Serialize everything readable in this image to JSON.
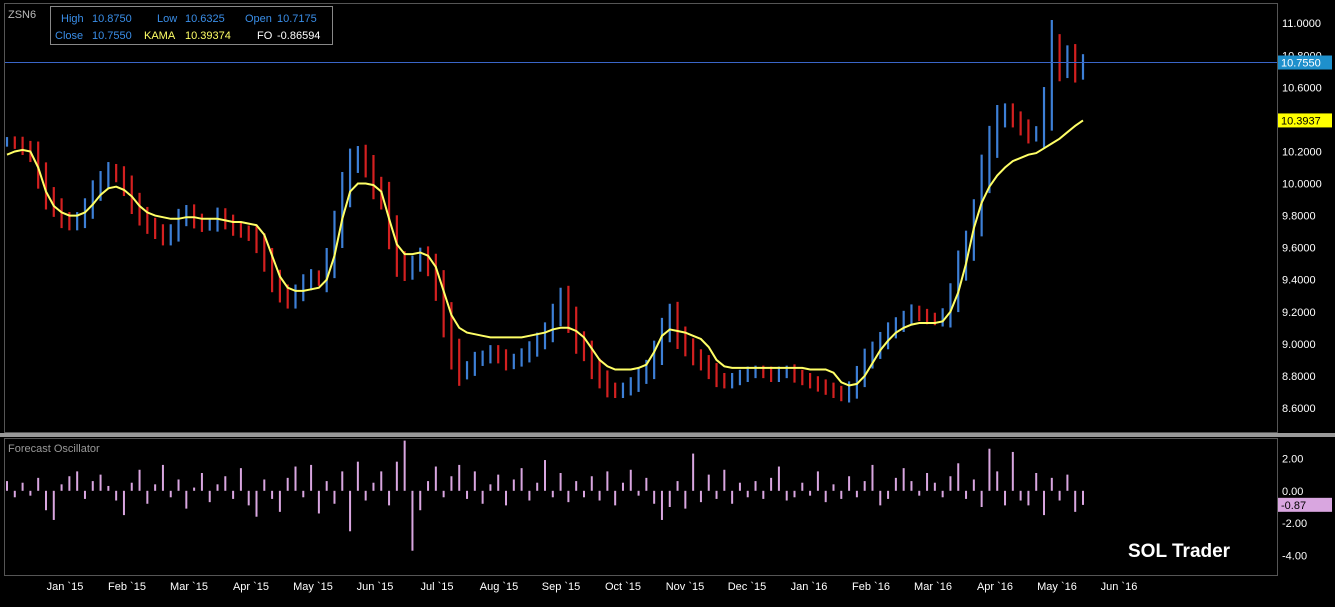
{
  "symbol": "ZSN6",
  "info_box": {
    "high_label": "High",
    "high_value": "10.8750",
    "low_label": "Low",
    "low_value": "10.6325",
    "open_label": "Open",
    "open_value": "10.7175",
    "close_label": "Close",
    "close_value": "10.7550",
    "kama_label": "KAMA",
    "kama_value": "10.39374",
    "fo_label": "FO",
    "fo_value": "-0.86594"
  },
  "indicator_title": "Forecast Oscillator",
  "watermark": "SOL Trader",
  "colors": {
    "background": "#000000",
    "up_bar": "#3d7fd6",
    "down_bar": "#d42020",
    "kama_line": "#ffff66",
    "close_line": "#3a66c8",
    "close_tag": "#1e90cc",
    "kama_tag": "#ffff00",
    "oscillator_bar": "#d9a6e0",
    "axis_text": "#ffffff",
    "border": "#555555"
  },
  "chart_data": [
    {
      "type": "bar",
      "subtype": "ohlc-price",
      "title": "",
      "xlabel": "",
      "ylabel": "",
      "x_tick_labels": [
        "Jan `15",
        "Feb `15",
        "Mar `15",
        "Apr `15",
        "May `15",
        "Jun `15",
        "Jul `15",
        "Aug `15",
        "Sep `15",
        "Oct `15",
        "Nov `15",
        "Dec `15",
        "Jan `16",
        "Feb `16",
        "Mar `16",
        "Apr `16",
        "May `16",
        "Jun `16"
      ],
      "y_tick_labels": [
        "11.0000",
        "10.8000",
        "10.6000",
        "10.4000",
        "10.2000",
        "10.0000",
        "9.8000",
        "9.6000",
        "9.4000",
        "9.2000",
        "9.0000",
        "8.8000",
        "8.6000"
      ],
      "ylim": [
        8.45,
        11.12
      ],
      "grid": false,
      "last_close": 10.755,
      "last_close_label": "10.7550",
      "last_kama": 10.3937,
      "last_kama_label": "10.3937",
      "series": [
        {
          "name": "Close",
          "values": [
            10.26,
            10.25,
            10.22,
            10.18,
            10.05,
            9.92,
            9.85,
            9.78,
            9.75,
            9.78,
            9.85,
            9.95,
            10.02,
            10.08,
            10.05,
            9.98,
            9.88,
            9.8,
            9.74,
            9.7,
            9.66,
            9.7,
            9.78,
            9.82,
            9.77,
            9.74,
            9.75,
            9.8,
            9.76,
            9.72,
            9.7,
            9.68,
            9.62,
            9.52,
            9.4,
            9.32,
            9.27,
            9.32,
            9.38,
            9.42,
            9.4,
            9.52,
            9.72,
            9.95,
            10.12,
            10.18,
            10.1,
            9.98,
            9.9,
            9.7,
            9.52,
            9.45,
            9.5,
            9.55,
            9.48,
            9.35,
            9.15,
            8.95,
            8.82,
            8.85,
            8.9,
            8.92,
            8.95,
            8.92,
            8.88,
            8.9,
            8.93,
            8.97,
            9.02,
            9.08,
            9.18,
            9.28,
            9.15,
            9.02,
            8.95,
            8.85,
            8.78,
            8.72,
            8.7,
            8.72,
            8.75,
            8.8,
            8.85,
            8.95,
            9.08,
            9.18,
            9.05,
            8.98,
            8.92,
            8.88,
            8.83,
            8.78,
            8.76,
            8.78,
            8.8,
            8.82,
            8.83,
            8.82,
            8.8,
            8.82,
            8.83,
            8.8,
            8.78,
            8.76,
            8.74,
            8.72,
            8.7,
            8.68,
            8.72,
            8.8,
            8.9,
            8.96,
            9.02,
            9.08,
            9.12,
            9.16,
            9.2,
            9.18,
            9.16,
            9.15,
            9.18,
            9.3,
            9.48,
            9.62,
            9.8,
            10.05,
            10.25,
            10.4,
            10.45,
            10.4,
            10.35,
            10.3,
            10.32,
            10.5,
            10.85,
            10.72,
            10.8,
            10.7,
            10.755
          ]
        },
        {
          "name": "KAMA",
          "values": [
            10.18,
            10.2,
            10.21,
            10.2,
            10.1,
            9.95,
            9.86,
            9.82,
            9.8,
            9.8,
            9.82,
            9.87,
            9.93,
            9.97,
            9.98,
            9.96,
            9.92,
            9.86,
            9.82,
            9.8,
            9.79,
            9.78,
            9.78,
            9.79,
            9.79,
            9.78,
            9.78,
            9.78,
            9.77,
            9.76,
            9.76,
            9.75,
            9.74,
            9.68,
            9.55,
            9.42,
            9.35,
            9.33,
            9.33,
            9.34,
            9.35,
            9.4,
            9.55,
            9.78,
            9.95,
            10.0,
            10.0,
            9.99,
            9.95,
            9.78,
            9.62,
            9.56,
            9.56,
            9.57,
            9.55,
            9.48,
            9.33,
            9.18,
            9.1,
            9.07,
            9.06,
            9.05,
            9.04,
            9.04,
            9.04,
            9.04,
            9.04,
            9.05,
            9.06,
            9.07,
            9.09,
            9.1,
            9.1,
            9.08,
            9.04,
            8.97,
            8.9,
            8.86,
            8.84,
            8.84,
            8.84,
            8.85,
            8.87,
            8.95,
            9.05,
            9.09,
            9.08,
            9.07,
            9.05,
            9.03,
            8.98,
            8.9,
            8.86,
            8.85,
            8.85,
            8.85,
            8.85,
            8.85,
            8.85,
            8.85,
            8.85,
            8.85,
            8.85,
            8.84,
            8.84,
            8.84,
            8.82,
            8.76,
            8.74,
            8.75,
            8.8,
            8.88,
            8.96,
            9.02,
            9.07,
            9.1,
            9.12,
            9.13,
            9.13,
            9.13,
            9.14,
            9.2,
            9.32,
            9.5,
            9.72,
            9.88,
            9.98,
            10.05,
            10.1,
            10.14,
            10.16,
            10.18,
            10.19,
            10.22,
            10.25,
            10.28,
            10.32,
            10.36,
            10.39374
          ]
        }
      ]
    },
    {
      "type": "bar",
      "subtype": "oscillator",
      "title": "Forecast Oscillator",
      "y_tick_labels": [
        "2.00",
        "0.00",
        "-2.00",
        "-4.00"
      ],
      "ylim": [
        -5.2,
        3.2
      ],
      "last_value": -0.86594,
      "last_value_label": "-0.87",
      "values": [
        0.6,
        -0.4,
        0.5,
        -0.3,
        0.8,
        -1.2,
        -1.8,
        0.4,
        0.9,
        1.2,
        -0.5,
        0.6,
        1.0,
        0.3,
        -0.6,
        -1.5,
        0.5,
        1.3,
        -0.8,
        0.4,
        1.6,
        -0.4,
        0.7,
        -1.1,
        0.2,
        1.1,
        -0.7,
        0.4,
        0.9,
        -0.5,
        1.4,
        -0.9,
        -1.6,
        0.7,
        -0.5,
        -1.3,
        0.8,
        1.5,
        -0.4,
        1.6,
        -1.4,
        0.6,
        -0.8,
        1.2,
        -2.5,
        1.8,
        -0.6,
        0.5,
        1.2,
        -0.9,
        1.8,
        3.1,
        -3.7,
        -1.2,
        0.6,
        1.5,
        -0.4,
        0.9,
        1.6,
        -0.5,
        1.2,
        -0.8,
        0.4,
        1.0,
        -0.9,
        0.7,
        1.4,
        -0.6,
        0.5,
        1.9,
        -0.4,
        1.1,
        -0.7,
        0.6,
        -0.4,
        0.9,
        -0.6,
        1.2,
        -0.9,
        0.5,
        1.3,
        -0.3,
        0.8,
        -0.8,
        -1.8,
        -1.0,
        0.6,
        -1.1,
        2.3,
        -0.7,
        1.0,
        -0.5,
        1.3,
        -0.8,
        0.5,
        -0.4,
        0.6,
        -0.5,
        0.8,
        1.5,
        -0.6,
        -0.4,
        0.5,
        -0.3,
        1.2,
        -0.7,
        0.4,
        -0.5,
        0.9,
        -0.4,
        0.6,
        1.6,
        -0.9,
        -0.5,
        0.8,
        1.4,
        0.6,
        -0.3,
        1.1,
        0.5,
        -0.4,
        0.9,
        1.7,
        -0.5,
        0.7,
        -1.0,
        2.6,
        1.2,
        -0.9,
        2.4,
        -0.6,
        -0.9,
        1.1,
        -1.5,
        0.8,
        -0.6,
        1.0,
        -1.3,
        -0.87
      ]
    }
  ]
}
